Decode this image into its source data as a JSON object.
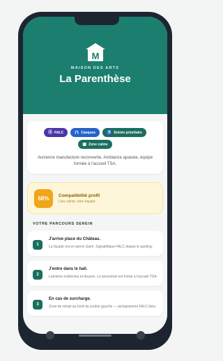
{
  "header": {
    "subtitle": "MAISON DES ARTS",
    "title": "La Parenthèse",
    "logo_letter": "M",
    "color": "#1b7e6f"
  },
  "badges": [
    {
      "icon": "falc-icon",
      "glyph": "Ⓐ",
      "label": "FALC",
      "color": "#4b35a8"
    },
    {
      "icon": "headphones-icon",
      "glyph": "🎧",
      "label": "Casques",
      "color": "#2563c9"
    },
    {
      "icon": "accessibility-icon",
      "glyph": "♿",
      "label": "Entrée prioritaire",
      "color": "#1b6e5f"
    },
    {
      "icon": "calm-zone-icon",
      "glyph": "▣",
      "label": "Zone calme",
      "color": "#1b6e5f"
    }
  ],
  "description": "Ancienne manufacture reconvertie. Ambiance apaisée, équipe formée à l'accueil TSA.",
  "compatibility": {
    "percent_label": "68%",
    "percent": 68,
    "title": "Compatibilité profil",
    "subtitle": "Lieu calme, bien équipé",
    "color": "#f2a519"
  },
  "section_title": "VOTRE PARCOURS SEREIN",
  "steps": [
    {
      "num": "1",
      "title": "J'arrive place du Château.",
      "text": "La façade est en pierre claire. Signalétique FALC depuis le parking."
    },
    {
      "num": "2",
      "title": "J'entre dans le hall.",
      "text": "Lumières indirectes et douces. Le personnel est formé à l'accueil TSA."
    },
    {
      "num": "3",
      "title": "En cas de surcharge.",
      "text": "Zone de retrait au fond du couloir gauche — pictogramme FALC bleu."
    }
  ]
}
